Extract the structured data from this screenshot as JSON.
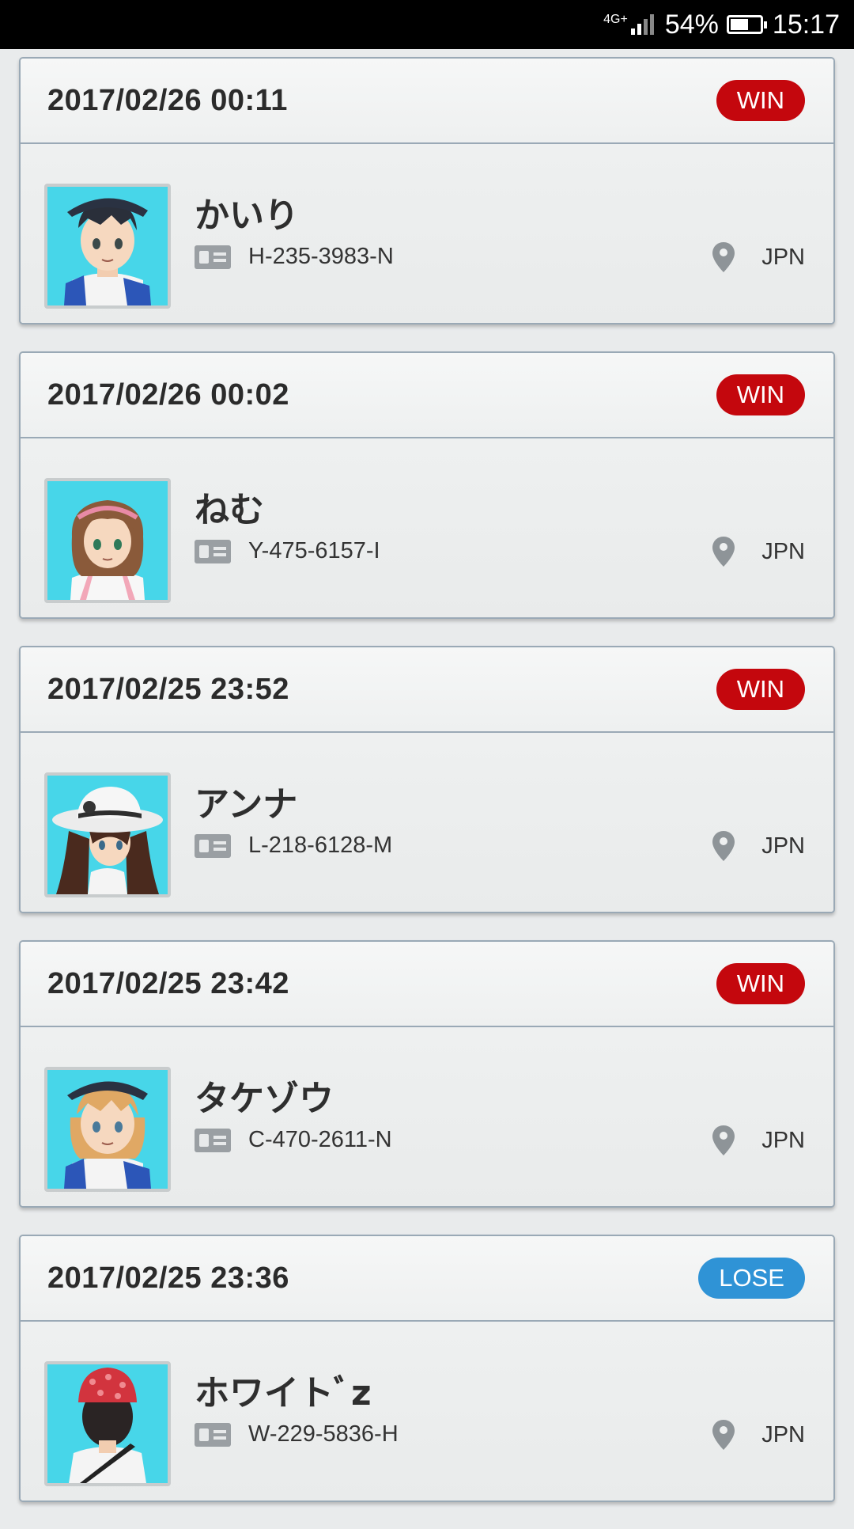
{
  "status_bar": {
    "network": "4G+",
    "battery_percent": "54%",
    "time": "15:17"
  },
  "battles": [
    {
      "datetime": "2017/02/26 00:11",
      "result": "WIN",
      "name": "かいり",
      "code": "H-235-3983-N",
      "region": "JPN",
      "avatar": "trainer-boy-black-cap"
    },
    {
      "datetime": "2017/02/26 00:02",
      "result": "WIN",
      "name": "ねむ",
      "code": "Y-475-6157-I",
      "region": "JPN",
      "avatar": "trainer-girl-brown-hair-headband"
    },
    {
      "datetime": "2017/02/25 23:52",
      "result": "WIN",
      "name": "アンナ",
      "code": "L-218-6128-M",
      "region": "JPN",
      "avatar": "trainer-girl-white-sunhat"
    },
    {
      "datetime": "2017/02/25 23:42",
      "result": "WIN",
      "name": "タケゾウ",
      "code": "C-470-2611-N",
      "region": "JPN",
      "avatar": "trainer-boy-blonde-cap"
    },
    {
      "datetime": "2017/02/25 23:36",
      "result": "LOSE",
      "name": "ホワイトﾞz",
      "code": "W-229-5836-H",
      "region": "JPN",
      "avatar": "trainer-girl-red-beanie-back"
    }
  ],
  "colors": {
    "win": "#c4070d",
    "lose": "#2f93d6",
    "avatar_bg": "#47d6e9"
  }
}
